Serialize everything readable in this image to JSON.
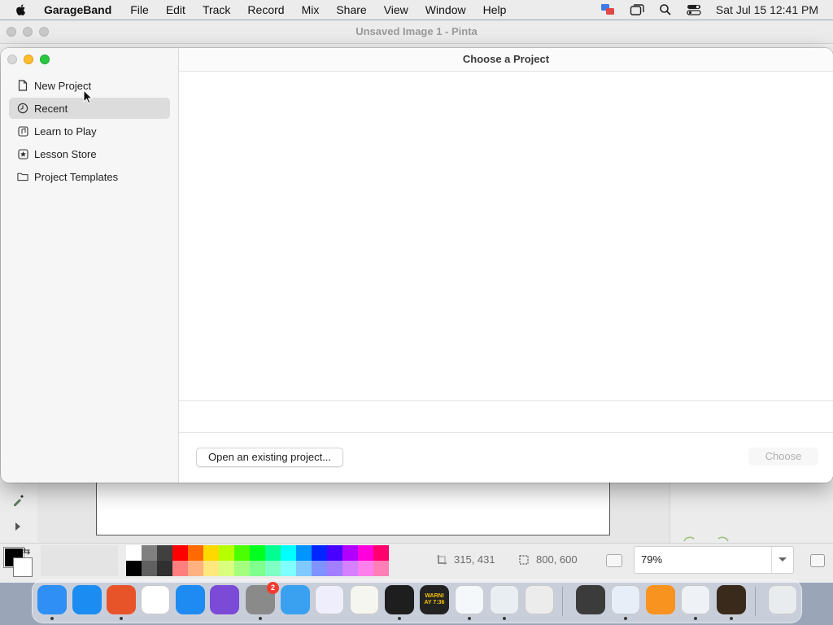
{
  "menubar": {
    "app_name": "GarageBand",
    "menus": [
      "File",
      "Edit",
      "Track",
      "Record",
      "Mix",
      "Share",
      "View",
      "Window",
      "Help"
    ],
    "clock": "Sat Jul 15  12:41 PM",
    "status_icons": [
      "screen-share-icon",
      "window-icon",
      "search-icon",
      "control-center-icon"
    ]
  },
  "pinta": {
    "window_title": "Unsaved Image 1 - Pinta",
    "cursor_position": "315, 431",
    "image_size": "800, 600",
    "zoom": "79%",
    "palette_top": [
      "#ffffff",
      "#808080",
      "#404040",
      "#ff0000",
      "#ff6a00",
      "#ffd800",
      "#b6ff00",
      "#4cff00",
      "#00ff21",
      "#00ff90",
      "#00ffff",
      "#0094ff",
      "#0026ff",
      "#4800ff",
      "#b200ff",
      "#ff00dc",
      "#ff006e"
    ],
    "palette_bottom": [
      "#000000",
      "#606060",
      "#303030",
      "#ff7f7f",
      "#ffb27f",
      "#ffe97f",
      "#daff7f",
      "#a5ff7f",
      "#7fff8e",
      "#7fffc5",
      "#7fffff",
      "#7fc9ff",
      "#7f92ff",
      "#a17fff",
      "#d67fff",
      "#ff7fed",
      "#ff7fb6"
    ]
  },
  "garageband": {
    "title": "Choose a Project",
    "nav": [
      {
        "label": "New Project",
        "icon": "document-icon",
        "selected": false
      },
      {
        "label": "Recent",
        "icon": "clock-icon",
        "selected": true
      },
      {
        "label": "Learn to Play",
        "icon": "music-note-icon",
        "selected": false
      },
      {
        "label": "Lesson Store",
        "icon": "star-icon",
        "selected": false
      },
      {
        "label": "Project Templates",
        "icon": "folder-icon",
        "selected": false
      }
    ],
    "open_existing_label": "Open an existing project...",
    "choose_label": "Choose"
  },
  "dock": {
    "apps": [
      {
        "name": "Finder",
        "icon": "finder-icon",
        "color": "#2f8ff5"
      },
      {
        "name": "Safari",
        "icon": "safari-icon",
        "color": "#1b8cf2"
      },
      {
        "name": "Firefox",
        "icon": "firefox-icon",
        "color": "#e8542a"
      },
      {
        "name": "Chrome",
        "icon": "chrome-icon",
        "color": "#ffffff"
      },
      {
        "name": "App Store",
        "icon": "app-store-icon",
        "color": "#1d8bf1"
      },
      {
        "name": "Apple Configurator",
        "icon": "configurator-icon",
        "color": "#7b4ad6"
      },
      {
        "name": "System Settings",
        "icon": "settings-icon",
        "color": "#8a8a8a",
        "badge": "2"
      },
      {
        "name": "Weather",
        "icon": "weather-icon",
        "color": "#3aa0f0"
      },
      {
        "name": "Visual Studio",
        "icon": "visual-studio-icon",
        "color": "#efeefc"
      },
      {
        "name": "TextEdit",
        "icon": "textedit-icon",
        "color": "#f6f6f0"
      },
      {
        "name": "Terminal",
        "icon": "terminal-icon",
        "color": "#1e1e1e"
      },
      {
        "name": "Console",
        "icon": "console-icon",
        "color": "#222222",
        "text": "WARNI\nAY 7:36"
      },
      {
        "name": "VS Code",
        "icon": "vscode-icon",
        "color": "#f4f8fb"
      },
      {
        "name": "Preview",
        "icon": "preview-icon",
        "color": "#e9eef3"
      },
      {
        "name": "Launchpad",
        "icon": "launchpad-icon",
        "color": "#ececec"
      },
      {
        "name": "Calculator",
        "icon": "calculator-icon",
        "color": "#3b3b3b"
      },
      {
        "name": "Screen Sharing",
        "icon": "screen-sharing-icon",
        "color": "#e8eef8"
      },
      {
        "name": "Books",
        "icon": "books-icon",
        "color": "#f7931e"
      },
      {
        "name": "Pinta",
        "icon": "pinta-icon",
        "color": "#eef2f6"
      },
      {
        "name": "GarageBand",
        "icon": "garageband-icon",
        "color": "#3a2a1c"
      },
      {
        "name": "Trash",
        "icon": "trash-icon",
        "color": "#e8ecef"
      }
    ]
  }
}
